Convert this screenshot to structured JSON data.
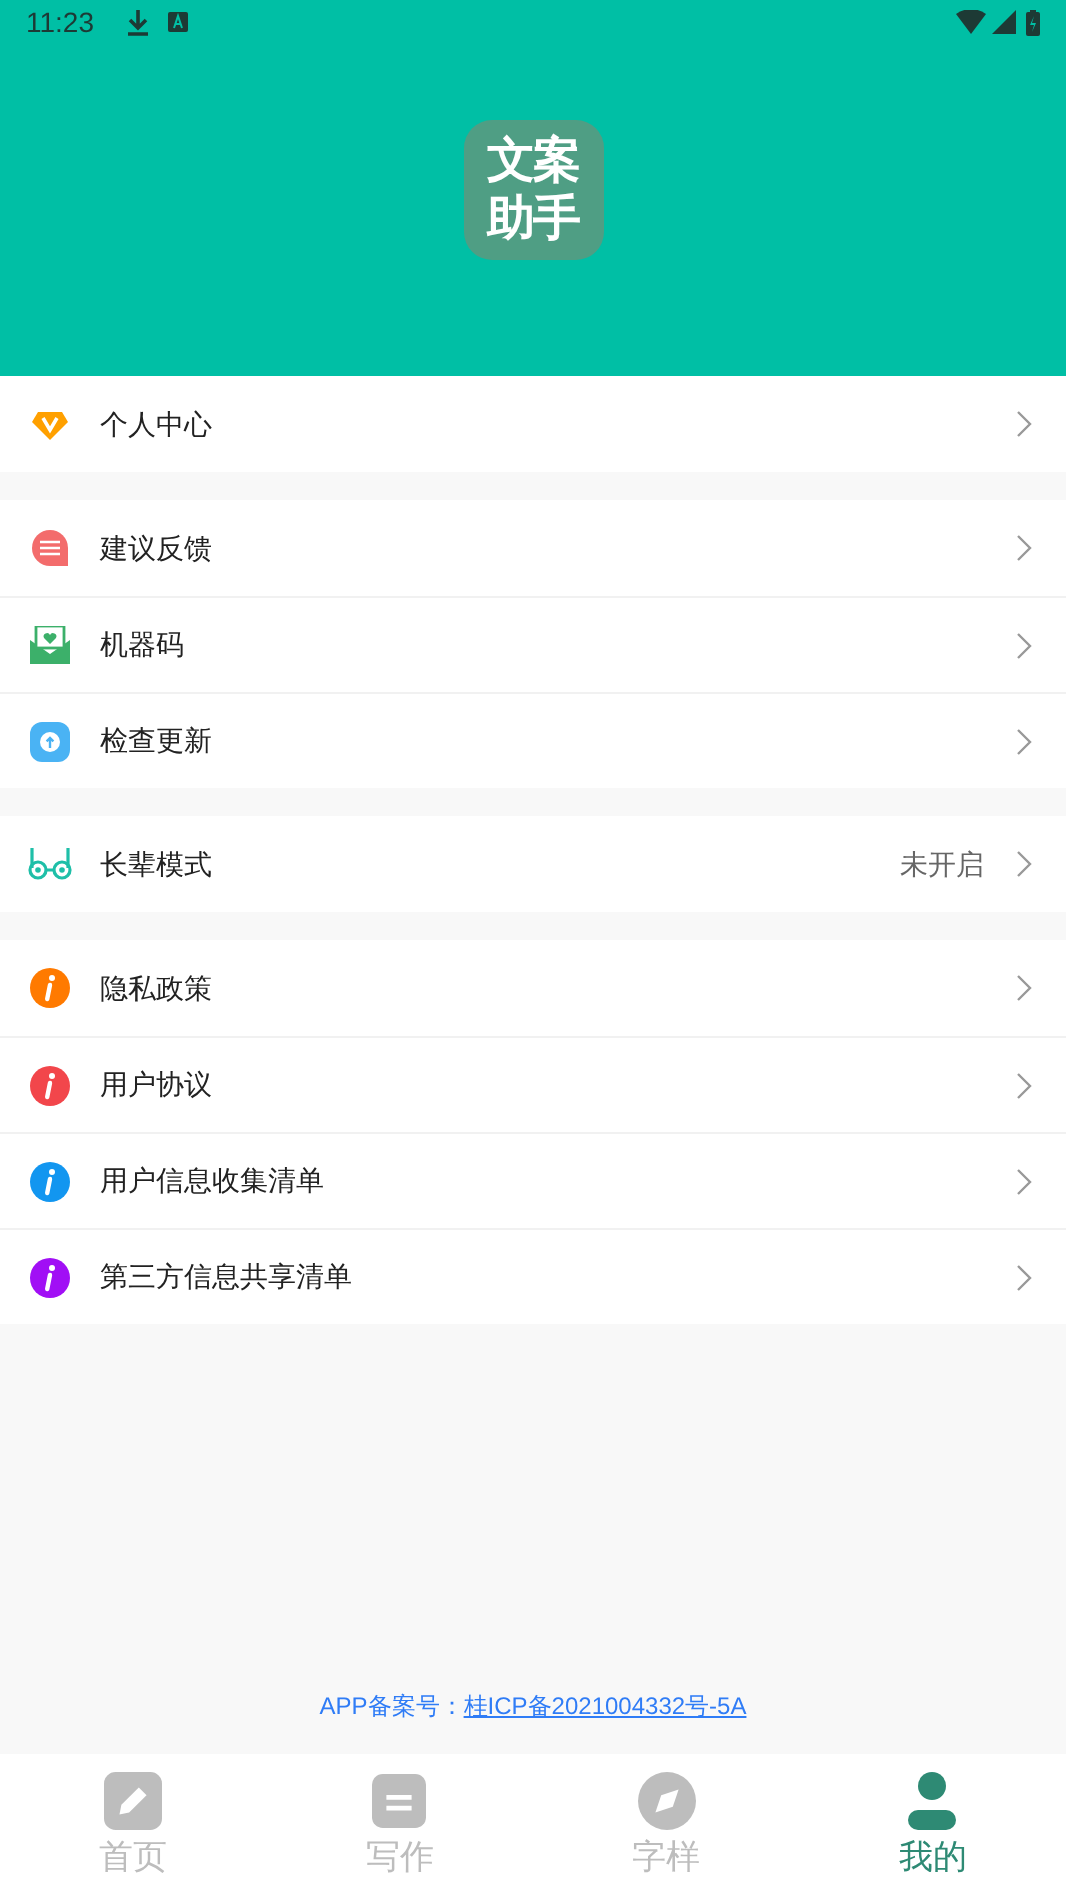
{
  "status_bar": {
    "time": "11:23"
  },
  "header": {
    "logo_lines": [
      "文案",
      "助手"
    ]
  },
  "groups": [
    [
      {
        "label": "个人中心",
        "kind": "vip",
        "color": "#ffa000"
      }
    ],
    [
      {
        "label": "建议反馈",
        "kind": "feedback",
        "color": "#f36c6c"
      },
      {
        "label": "机器码",
        "kind": "mail",
        "color": "#3cb06a"
      },
      {
        "label": "检查更新",
        "kind": "update",
        "color": "#4ab3f4"
      }
    ],
    [
      {
        "label": "长辈模式",
        "kind": "glasses",
        "color": "#1fbfa8",
        "value": "未开启"
      }
    ],
    [
      {
        "label": "隐私政策",
        "kind": "info",
        "color": "#ff7a00"
      },
      {
        "label": "用户协议",
        "kind": "info",
        "color": "#f2464b"
      },
      {
        "label": "用户信息收集清单",
        "kind": "info",
        "color": "#1296f0"
      },
      {
        "label": "第三方信息共享清单",
        "kind": "info",
        "color": "#a10ff5"
      }
    ]
  ],
  "footer": {
    "label": "APP备案号：",
    "link": "桂ICP备2021004332号-5A"
  },
  "tabs": [
    {
      "label": "首页",
      "kind": "edit",
      "selected": false
    },
    {
      "label": "写作",
      "kind": "write",
      "selected": false
    },
    {
      "label": "字样",
      "kind": "compass",
      "selected": false
    },
    {
      "label": "我的",
      "kind": "person",
      "selected": true
    }
  ]
}
